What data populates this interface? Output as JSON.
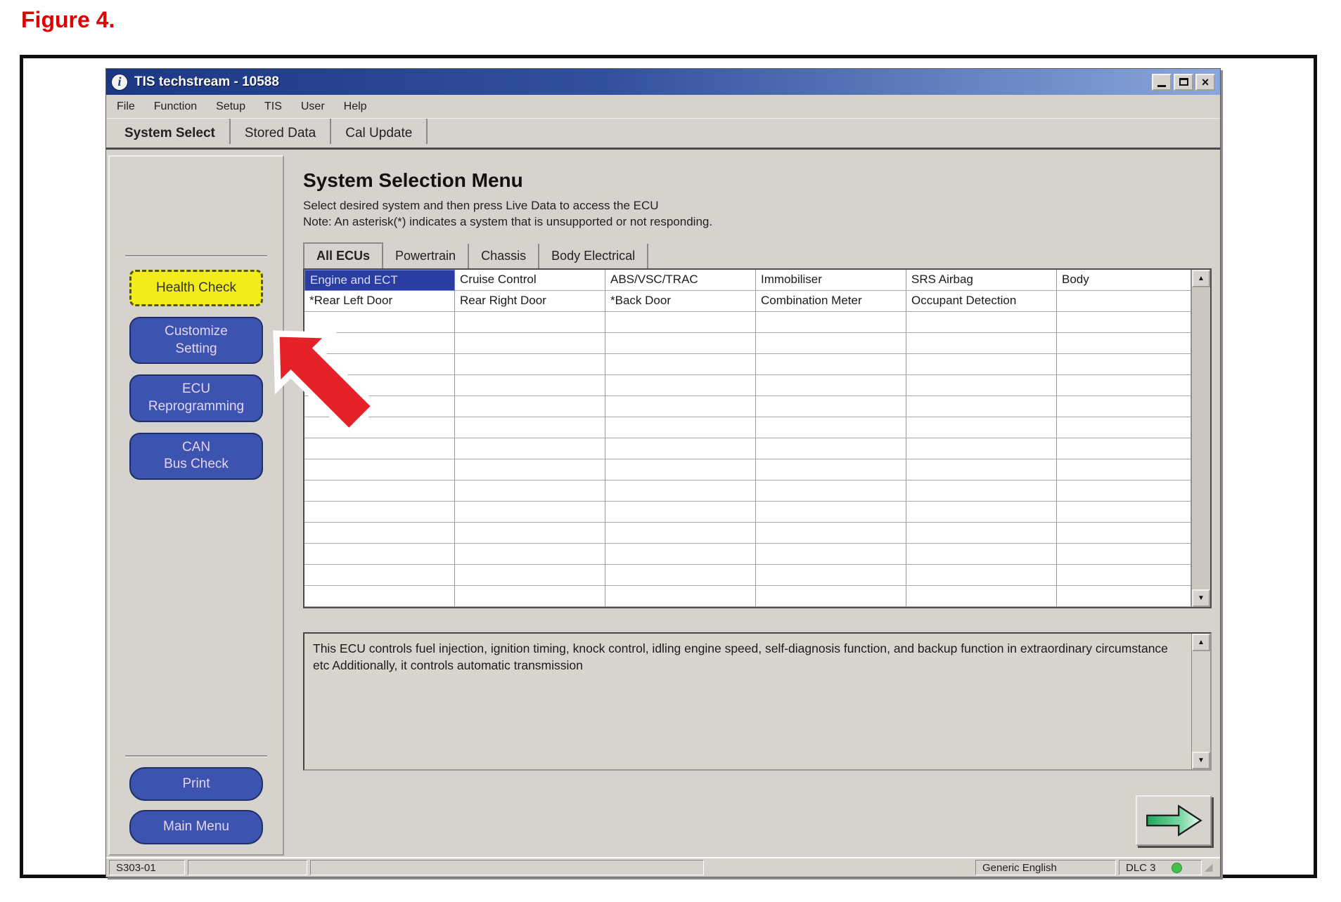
{
  "figure_label": "Figure 4.",
  "colors": {
    "titlebar_blue": "#1c3884",
    "accent_yellow": "#f3ee1b",
    "button_blue": "#3c53b0",
    "selected_cell_blue": "#2b3da0",
    "callout_arrow_red": "#e52228",
    "status_green": "#43c04a"
  },
  "window": {
    "title": "TIS techstream - 10588",
    "controls": {
      "minimize": "minimize",
      "maximize": "maximize",
      "close": "close"
    },
    "menu_items": [
      "File",
      "Function",
      "Setup",
      "TIS",
      "User",
      "Help"
    ],
    "main_tabs": [
      {
        "label": "System Select",
        "active": true
      },
      {
        "label": "Stored Data",
        "active": false
      },
      {
        "label": "Cal Update",
        "active": false
      }
    ]
  },
  "sidebar": {
    "buttons_top": [
      {
        "id": "health-check",
        "style": "yellow",
        "label_lines": [
          "Health Check"
        ]
      },
      {
        "id": "customize-setting",
        "style": "blue",
        "label_lines": [
          "Customize",
          "Setting"
        ]
      },
      {
        "id": "ecu-reprogramming",
        "style": "blue",
        "label_lines": [
          "ECU",
          "Reprogramming"
        ]
      },
      {
        "id": "can-bus-check",
        "style": "blue",
        "label_lines": [
          "CAN",
          "Bus Check"
        ]
      }
    ],
    "buttons_bottom": [
      {
        "id": "print",
        "style": "blue-pill",
        "label_lines": [
          "Print"
        ]
      },
      {
        "id": "main-menu",
        "style": "blue-pill",
        "label_lines": [
          "Main Menu"
        ]
      }
    ]
  },
  "main": {
    "heading": "System Selection Menu",
    "instruction": "Select desired system and then press Live Data to access the ECU",
    "note": "Note: An asterisk(*) indicates a system that is unsupported or not responding.",
    "ecu_tabs": [
      {
        "label": "All ECUs",
        "active": true
      },
      {
        "label": "Powertrain",
        "active": false
      },
      {
        "label": "Chassis",
        "active": false
      },
      {
        "label": "Body Electrical",
        "active": false
      }
    ],
    "table": {
      "rows": [
        [
          {
            "text": "Engine and ECT",
            "selected": true
          },
          {
            "text": "Cruise Control",
            "selected": false
          },
          {
            "text": "ABS/VSC/TRAC",
            "selected": false
          },
          {
            "text": "Immobiliser",
            "selected": false
          },
          {
            "text": "SRS Airbag",
            "selected": false
          },
          {
            "text": "Body",
            "selected": false
          }
        ],
        [
          {
            "text": "*Rear Left Door",
            "selected": false
          },
          {
            "text": "Rear Right Door",
            "selected": false
          },
          {
            "text": "*Back Door",
            "selected": false
          },
          {
            "text": "Combination Meter",
            "selected": false
          },
          {
            "text": "Occupant Detection",
            "selected": false
          },
          {
            "text": "",
            "selected": false
          }
        ]
      ],
      "empty_row_count": 14,
      "columns": 6
    },
    "description": "This ECU controls fuel injection, ignition timing, knock control, idling engine speed, self-diagnosis function, and backup function in extraordinary circumstance etc Additionally, it controls automatic transmission",
    "next_button": "next-arrow"
  },
  "status_bar": {
    "left": "S303-01",
    "language": "Generic English",
    "dlc": "DLC 3"
  }
}
